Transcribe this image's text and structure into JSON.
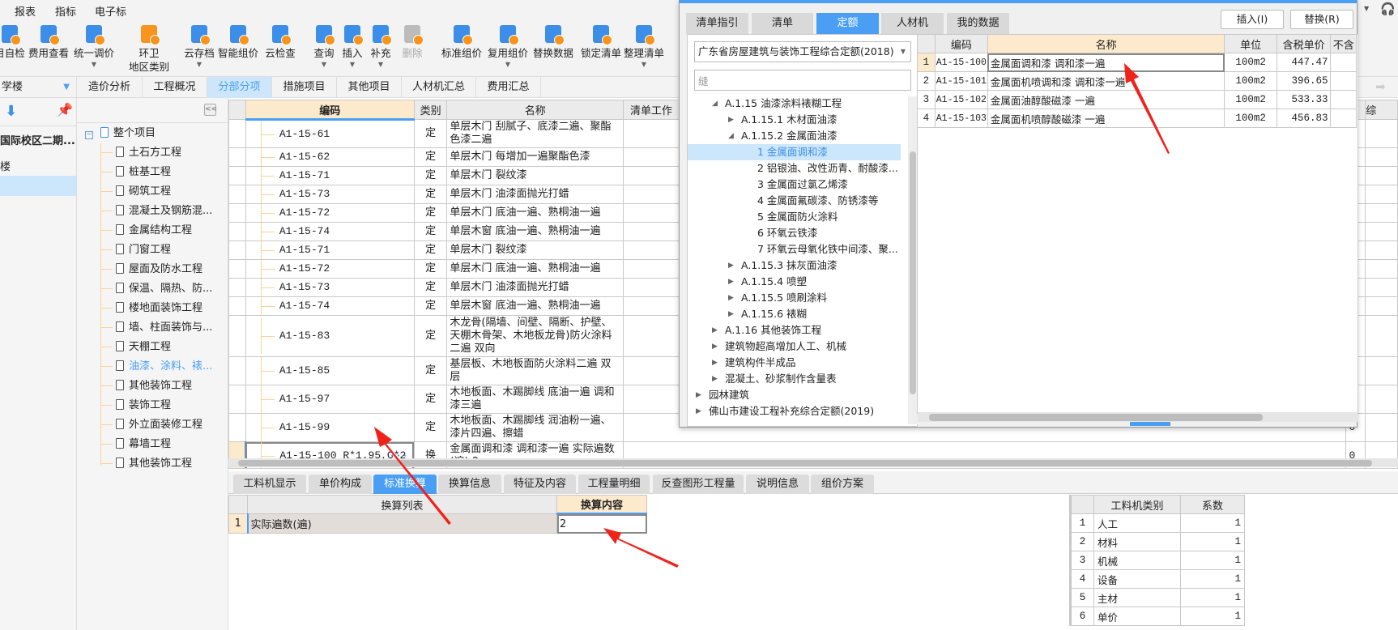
{
  "menu": [
    "报表",
    "指标",
    "电子标"
  ],
  "toolbar": [
    {
      "label": "目自检",
      "icon": "self-check-icon",
      "dd": false
    },
    {
      "label": "费用查看",
      "icon": "fee-view-icon",
      "dd": false
    },
    {
      "label": "统一调价",
      "icon": "unified-price-icon",
      "dd": true
    },
    {
      "label": "环卫",
      "label2": "地区类别",
      "icon": "region-category-icon",
      "dd": false
    },
    {
      "label": "云存档",
      "icon": "cloud-archive-icon",
      "dd": true
    },
    {
      "label": "智能组价",
      "icon": "smart-pricing-icon",
      "dd": false
    },
    {
      "label": "云检查",
      "icon": "cloud-check-icon",
      "dd": false
    },
    {
      "label": "查询",
      "icon": "query-icon",
      "dd": true
    },
    {
      "label": "插入",
      "icon": "insert-icon",
      "dd": true
    },
    {
      "label": "补充",
      "icon": "supplement-icon",
      "dd": true
    },
    {
      "label": "删除",
      "icon": "trash-icon",
      "dd": false,
      "disabled": true
    },
    {
      "label": "标准组价",
      "icon": "standard-pricing-icon",
      "dd": false
    },
    {
      "label": "复用组价",
      "icon": "reuse-pricing-icon",
      "dd": true
    },
    {
      "label": "替换数据",
      "icon": "replace-data-icon",
      "dd": false
    },
    {
      "label": "锁定清单",
      "icon": "lock-icon",
      "dd": false
    },
    {
      "label": "整理清单",
      "icon": "organize-list-icon",
      "dd": true
    }
  ],
  "left_panel": {
    "dropdown": "学楼",
    "project": "国际校区二期...",
    "building": "楼"
  },
  "main_tabs": [
    "造价分析",
    "工程概况",
    "分部分项",
    "措施项目",
    "其他项目",
    "人材机汇总",
    "费用汇总"
  ],
  "main_tabs_active": "分部分项",
  "tree": {
    "root": "整个项目",
    "items": [
      "土石方工程",
      "桩基工程",
      "砌筑工程",
      "混凝土及钢筋混...",
      "金属结构工程",
      "门窗工程",
      "屋面及防水工程",
      "保温、隔热、防...",
      "楼地面装饰工程",
      "墙、柱面装饰与...",
      "天棚工程",
      "油漆、涂料、裱...",
      "其他装饰工程",
      "装饰工程",
      "外立面装修工程",
      "幕墙工程",
      "其他装饰工程"
    ],
    "selected_index": 11
  },
  "main_grid": {
    "headers": {
      "code": "编码",
      "type": "类别",
      "name": "名称",
      "work": "清单工作",
      "extra1": "",
      "extra2": "综"
    },
    "rows": [
      {
        "code": "A1-15-61",
        "type": "定",
        "name": "单层木门 刮腻子、底漆二遍、聚酯色漆二遍",
        "v": "0"
      },
      {
        "code": "A1-15-62",
        "type": "定",
        "name": "单层木门 每增加一遍聚酯色漆",
        "v": "0"
      },
      {
        "code": "A1-15-71",
        "type": "定",
        "name": "单层木门 裂纹漆",
        "v": "0"
      },
      {
        "code": "A1-15-73",
        "type": "定",
        "name": "单层木门 油漆面抛光打蜡",
        "v": "0"
      },
      {
        "code": "A1-15-72",
        "type": "定",
        "name": "单层木门 底油一遍、熟桐油一遍",
        "v": "0"
      },
      {
        "code": "A1-15-74",
        "type": "定",
        "name": "单层木窗 底油一遍、熟桐油一遍",
        "v": "0"
      },
      {
        "code": "A1-15-71",
        "type": "定",
        "name": "单层木门 裂纹漆",
        "v": "0"
      },
      {
        "code": "A1-15-72",
        "type": "定",
        "name": "单层木门 底油一遍、熟桐油一遍",
        "v": "0"
      },
      {
        "code": "A1-15-73",
        "type": "定",
        "name": "单层木门 油漆面抛光打蜡",
        "v": "0"
      },
      {
        "code": "A1-15-74",
        "type": "定",
        "name": "单层木窗 底油一遍、熟桐油一遍",
        "v": "0"
      },
      {
        "code": "A1-15-83",
        "type": "定",
        "name": "木龙骨(隔墙、间壁、隔断、护壁、天棚木骨架、木地板龙骨)防火涂料二遍 双向",
        "v": "0"
      },
      {
        "code": "A1-15-85",
        "type": "定",
        "name": "基层板、木地板面防火涂料二遍 双层",
        "v": "0"
      },
      {
        "code": "A1-15-97",
        "type": "定",
        "name": "木地板面、木踢脚线 底油一遍 调和漆三遍",
        "v": "0"
      },
      {
        "code": "A1-15-99",
        "type": "定",
        "name": "木地板面、木踢脚线 润油粉一遍、漆片四遍、擦蜡",
        "v": "0"
      },
      {
        "code": "A1-15-100 R*1.95,C*2",
        "type": "换",
        "name": "金属面调和漆 调和漆一遍   实际遍数(遍):2",
        "v": "0",
        "current": true,
        "more": "···"
      }
    ]
  },
  "bottom_tabs": [
    "工料机显示",
    "单价构成",
    "标准换算",
    "换算信息",
    "特征及内容",
    "工程量明细",
    "反查图形工程量",
    "说明信息",
    "组价方案"
  ],
  "bottom_tabs_active": "标准换算",
  "conversion": {
    "headers": [
      "换算列表",
      "换算内容"
    ],
    "rows": [
      {
        "n": "1",
        "item": "实际遍数(遍)",
        "value": "2"
      }
    ]
  },
  "coefficients": {
    "headers": [
      "工料机类别",
      "系数"
    ],
    "rows": [
      {
        "n": "1",
        "cat": "人工",
        "coef": "1"
      },
      {
        "n": "2",
        "cat": "材料",
        "coef": "1"
      },
      {
        "n": "3",
        "cat": "机械",
        "coef": "1"
      },
      {
        "n": "4",
        "cat": "设备",
        "coef": "1"
      },
      {
        "n": "5",
        "cat": "主材",
        "coef": "1"
      },
      {
        "n": "6",
        "cat": "单价",
        "coef": "1"
      }
    ]
  },
  "dialog": {
    "tabs": [
      "清单指引",
      "清单",
      "定额",
      "人材机",
      "我的数据"
    ],
    "active_tab": "定额",
    "insert_button": "插入(I)",
    "replace_button": "替换(R)",
    "quota_select": "广东省房屋建筑与装饰工程综合定额(2018)",
    "search_value": "缝",
    "tree": [
      {
        "label": "A.1.15 油漆涂料裱糊工程",
        "level": 1,
        "state": "open"
      },
      {
        "label": "A.1.15.1 木材面油漆",
        "level": 2,
        "state": "closed"
      },
      {
        "label": "A.1.15.2 金属面油漆",
        "level": 2,
        "state": "open"
      },
      {
        "label": "1 金属面调和漆",
        "level": 3,
        "selected": true
      },
      {
        "label": "2 铝银油、改性沥青、耐酸漆...",
        "level": 3
      },
      {
        "label": "3 金属面过氯乙烯漆",
        "level": 3
      },
      {
        "label": "4 金属面氟碳漆、防锈漆等",
        "level": 3
      },
      {
        "label": "5 金属面防火涂料",
        "level": 3
      },
      {
        "label": "6 环氧云铁漆",
        "level": 3
      },
      {
        "label": "7 环氧云母氧化铁中间漆、聚...",
        "level": 3
      },
      {
        "label": "A.1.15.3 抹灰面油漆",
        "level": 2,
        "state": "closed"
      },
      {
        "label": "A.1.15.4 喷塑",
        "level": 2,
        "state": "closed"
      },
      {
        "label": "A.1.15.5 喷刷涂料",
        "level": 2,
        "state": "closed"
      },
      {
        "label": "A.1.15.6 裱糊",
        "level": 2,
        "state": "closed"
      },
      {
        "label": "A.1.16 其他装饰工程",
        "level": 1,
        "state": "closed"
      },
      {
        "label": "建筑物超高增加人工、机械",
        "level": 1,
        "state": "closed"
      },
      {
        "label": "建筑构件半成品",
        "level": 1,
        "state": "closed"
      },
      {
        "label": "混凝土、砂浆制作含量表",
        "level": 1,
        "state": "closed"
      },
      {
        "label": "园林建筑",
        "level": 0,
        "state": "closed"
      },
      {
        "label": "佛山市建设工程补充综合定额(2019)",
        "level": 0,
        "state": "closed"
      }
    ],
    "grid_headers": [
      "编码",
      "名称",
      "单位",
      "含税单价",
      "不含"
    ],
    "grid_rows": [
      {
        "n": "1",
        "code": "A1-15-100",
        "name": "金属面调和漆 调和漆一遍",
        "unit": "100m2",
        "price": "447.47",
        "current": true
      },
      {
        "n": "2",
        "code": "A1-15-101",
        "name": "金属面机喷调和漆 调和漆一遍",
        "unit": "100m2",
        "price": "396.65"
      },
      {
        "n": "3",
        "code": "A1-15-102",
        "name": "金属面油醇酸磁漆 一遍",
        "unit": "100m2",
        "price": "533.33"
      },
      {
        "n": "4",
        "code": "A1-15-103",
        "name": "金属面机喷醇酸磁漆 一遍",
        "unit": "100m2",
        "price": "456.83"
      }
    ]
  },
  "colors": {
    "accent": "#4a9ff5",
    "header_selected": "#fde9cc",
    "annotation_arrow": "#f0231b",
    "icon_orange": "#f7941d",
    "icon_blue": "#3c8ee8"
  }
}
